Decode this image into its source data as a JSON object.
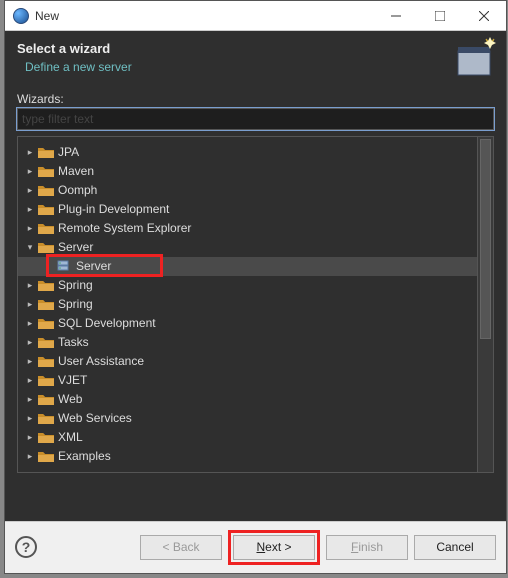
{
  "window": {
    "title": "New"
  },
  "header": {
    "title": "Select a wizard",
    "subtitle": "Define a new server"
  },
  "wizards": {
    "label": "Wizards:",
    "filter_placeholder": "type filter text"
  },
  "tree": {
    "items": [
      {
        "label": "JPA",
        "expanded": false
      },
      {
        "label": "Maven",
        "expanded": false
      },
      {
        "label": "Oomph",
        "expanded": false
      },
      {
        "label": "Plug-in Development",
        "expanded": false
      },
      {
        "label": "Remote System Explorer",
        "expanded": false
      },
      {
        "label": "Server",
        "expanded": true,
        "children": [
          {
            "label": "Server",
            "selected": true
          }
        ]
      },
      {
        "label": "Spring",
        "expanded": false
      },
      {
        "label": "Spring",
        "expanded": false
      },
      {
        "label": "SQL Development",
        "expanded": false
      },
      {
        "label": "Tasks",
        "expanded": false
      },
      {
        "label": "User Assistance",
        "expanded": false
      },
      {
        "label": "VJET",
        "expanded": false
      },
      {
        "label": "Web",
        "expanded": false
      },
      {
        "label": "Web Services",
        "expanded": false
      },
      {
        "label": "XML",
        "expanded": false
      },
      {
        "label": "Examples",
        "expanded": false
      }
    ]
  },
  "buttons": {
    "back": "< Back",
    "next": "Next >",
    "finish": "Finish",
    "cancel": "Cancel"
  }
}
